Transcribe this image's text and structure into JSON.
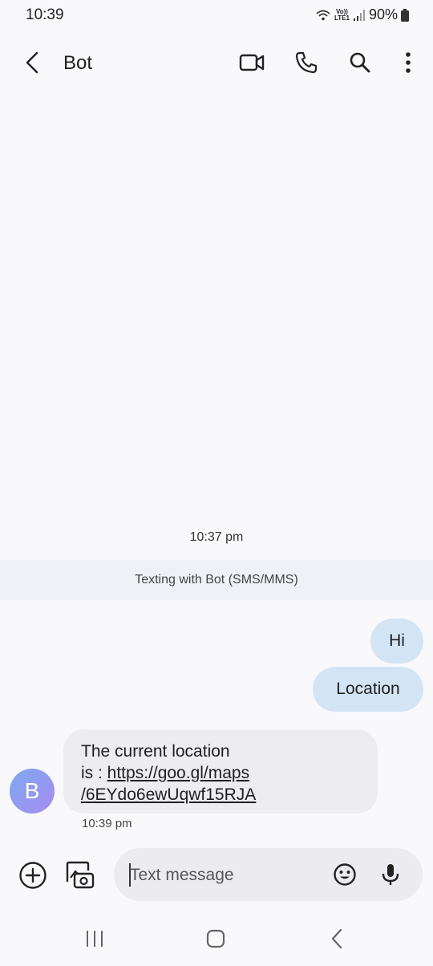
{
  "status_bar": {
    "time": "10:39",
    "volte_top": "Vo))",
    "volte_bottom": "LTE1",
    "battery": "90%"
  },
  "header": {
    "title": "Bot"
  },
  "conversation": {
    "date_divider": "10:37 pm",
    "banner": "Texting with Bot (SMS/MMS)",
    "outgoing": [
      {
        "text": "Hi"
      },
      {
        "text": "Location"
      }
    ],
    "incoming": {
      "avatar_letter": "B",
      "text_line1": "The current location",
      "text_prefix": "is : ",
      "link_line1": "https://goo.gl/maps",
      "link_line2": "/6EYdo6ewUqwf15RJA",
      "time": "10:39 pm"
    }
  },
  "composer": {
    "placeholder": "Text message"
  },
  "colors": {
    "outgoing_bubble": "#d3e4f5",
    "incoming_bubble": "#ededf0",
    "banner": "#eef1f5",
    "avatar_gradient_start": "#7da9f0",
    "avatar_gradient_end": "#a78cf0"
  }
}
